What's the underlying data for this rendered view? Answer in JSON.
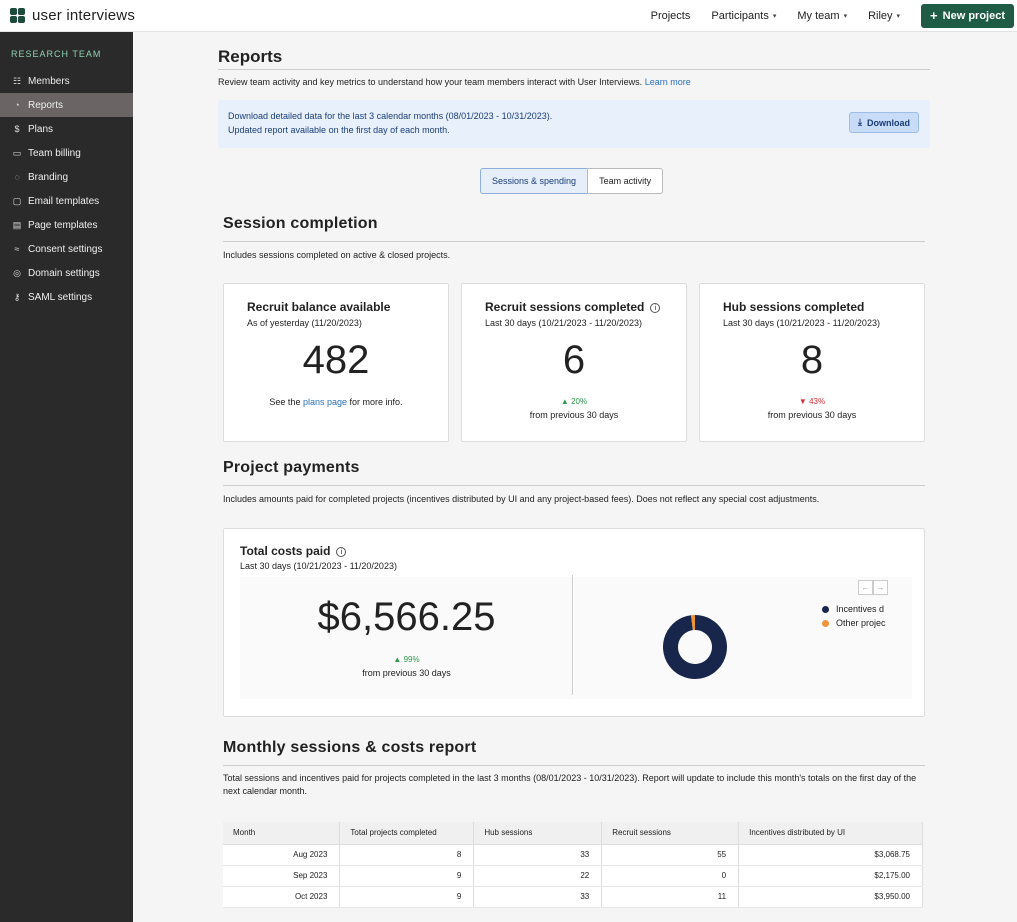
{
  "app": {
    "logo_text": "user interviews"
  },
  "topnav": {
    "items": [
      "Projects",
      "Participants",
      "My team",
      "Riley"
    ],
    "new_project": "New project"
  },
  "sidebar": {
    "heading": "RESEARCH TEAM",
    "items": [
      {
        "label": "Members",
        "icon": "members-icon",
        "glyph": "☷"
      },
      {
        "label": "Reports",
        "icon": "reports-icon",
        "glyph": "◔"
      },
      {
        "label": "Plans",
        "icon": "dollar-icon",
        "glyph": "$"
      },
      {
        "label": "Team billing",
        "icon": "credit-card-icon",
        "glyph": "▭"
      },
      {
        "label": "Branding",
        "icon": "palette-icon",
        "glyph": "◌"
      },
      {
        "label": "Email templates",
        "icon": "book-icon",
        "glyph": "▢"
      },
      {
        "label": "Page templates",
        "icon": "file-icon",
        "glyph": "▤"
      },
      {
        "label": "Consent settings",
        "icon": "handshake-icon",
        "glyph": "≈"
      },
      {
        "label": "Domain settings",
        "icon": "globe-icon",
        "glyph": "◎"
      },
      {
        "label": "SAML settings",
        "icon": "key-icon",
        "glyph": "⚷"
      }
    ],
    "active_index": 1
  },
  "reports": {
    "title": "Reports",
    "description": "Review team activity and key metrics to understand how your team members interact with User Interviews.",
    "learn_more": "Learn more",
    "banner_line1": "Download detailed data for the last 3 calendar months (08/01/2023 - 10/31/2023).",
    "banner_line2": "Updated report available on the first day of each month.",
    "download": "Download",
    "tabs": [
      "Sessions & spending",
      "Team activity"
    ]
  },
  "session_completion": {
    "title": "Session completion",
    "description": "Includes sessions completed on active & closed projects.",
    "cards": [
      {
        "title": "Recruit balance available",
        "subtitle": "As of yesterday (11/20/2023)",
        "value": "482",
        "foot_pre": "See the",
        "foot_link": "plans page",
        "foot_post": "for more info."
      },
      {
        "title": "Recruit sessions completed",
        "subtitle": "Last 30 days (10/21/2023 - 11/20/2023)",
        "value": "6",
        "change": "▲ 20%",
        "change_note": "from previous 30 days"
      },
      {
        "title": "Hub sessions completed",
        "subtitle": "Last 30 days (10/21/2023 - 11/20/2023)",
        "value": "8",
        "change": "▼ 43%",
        "change_note": "from previous 30 days"
      }
    ]
  },
  "project_payments": {
    "title": "Project payments",
    "description": "Includes amounts paid for completed projects (incentives distributed by UI and any project-based fees). Does not reflect any special cost adjustments.",
    "card_title": "Total costs paid",
    "card_subtitle": "Last 30 days (10/21/2023 - 11/20/2023)",
    "value": "$6,566.25",
    "change": "▲ 99%",
    "change_note": "from previous 30 days",
    "legend": [
      {
        "label": "Incentives d",
        "color": "#17264a"
      },
      {
        "label": "Other projec",
        "color": "#f0943a"
      }
    ]
  },
  "monthly": {
    "title": "Monthly sessions & costs report",
    "description": "Total sessions and incentives paid for projects completed in the last 3 months (08/01/2023 - 10/31/2023). Report will update to include this month's totals on the first day of the next calendar month.",
    "columns": [
      "Month",
      "Total projects completed",
      "Hub sessions",
      "Recruit sessions",
      "Incentives distributed by UI"
    ],
    "rows": [
      [
        "Aug 2023",
        "8",
        "33",
        "55",
        "$3,068.75"
      ],
      [
        "Sep 2023",
        "9",
        "22",
        "0",
        "$2,175.00"
      ],
      [
        "Oct 2023",
        "9",
        "33",
        "11",
        "$3,950.00"
      ]
    ]
  },
  "chart_data": {
    "type": "pie",
    "labels": [
      "Incentives d",
      "Other projec"
    ],
    "values": [
      0.98,
      0.02
    ],
    "colors": [
      "#17264a",
      "#f0943a"
    ]
  }
}
